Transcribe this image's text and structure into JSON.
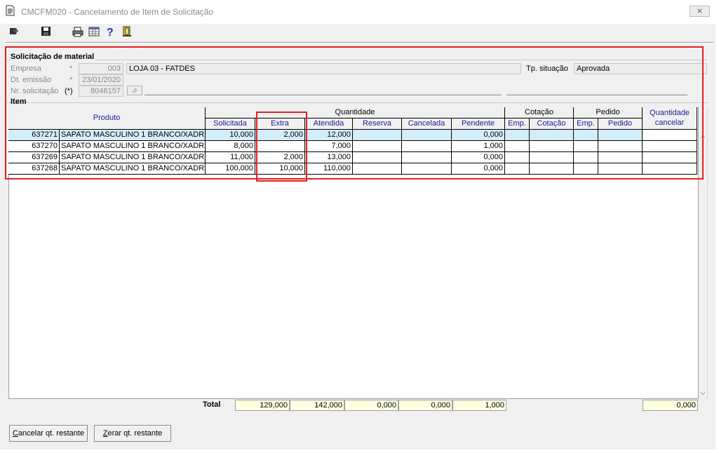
{
  "window": {
    "title": "CMCFM020 - Cancelamento de Item de Solicitação",
    "close_label": "⨯"
  },
  "toolbar": {
    "buttons": [
      "exit-icon",
      "save-icon",
      "print-icon",
      "grid-icon",
      "help-icon",
      "door-icon"
    ]
  },
  "header": {
    "group_title": "Solicitação de material",
    "empresa_label": "Empresa",
    "empresa_required": "*",
    "empresa_code": "003",
    "empresa_name": "LOJA 03 - FATDES",
    "dt_label": "Dt. emissão",
    "dt_required": "*",
    "dt_value": "23/01/2020",
    "nr_label": "Nr. solicitação",
    "nr_required": "(*)",
    "nr_value": "8046157",
    "tp_label": "Tp. situação",
    "tp_value": "Aprovada"
  },
  "grid": {
    "section_title": "Item",
    "headers": {
      "produto": "Produto",
      "quantidade": "Quantidade",
      "cotacao": "Cotação",
      "pedido": "Pedido",
      "qtd_cancelar": "Quantidade cancelar",
      "solicitada": "Solicitada",
      "extra": "Extra",
      "atendida": "Atendida",
      "reserva": "Reserva",
      "cancelada": "Cancelada",
      "pendente": "Pendente",
      "cot_emp": "Emp.",
      "cot_cotacao": "Cotação",
      "ped_emp": "Emp.",
      "ped_pedido": "Pedido"
    },
    "rows": [
      {
        "code": "637271",
        "desc": "SAPATO MASCULINO 1 BRANCO/XADREZ.",
        "solicitada": "10,000",
        "extra": "2,000",
        "atendida": "12,000",
        "reserva": "",
        "cancelada": "",
        "pendente": "0,000"
      },
      {
        "code": "637270",
        "desc": "SAPATO MASCULINO 1 BRANCO/XADREZ.",
        "solicitada": "8,000",
        "extra": "",
        "atendida": "7,000",
        "reserva": "",
        "cancelada": "",
        "pendente": "1,000"
      },
      {
        "code": "637269",
        "desc": "SAPATO MASCULINO 1 BRANCO/XADREZ.",
        "solicitada": "11,000",
        "extra": "2,000",
        "atendida": "13,000",
        "reserva": "",
        "cancelada": "",
        "pendente": "0,000"
      },
      {
        "code": "637268",
        "desc": "SAPATO MASCULINO 1 BRANCO/XADREZ.",
        "solicitada": "100,000",
        "extra": "10,000",
        "atendida": "110,000",
        "reserva": "",
        "cancelada": "",
        "pendente": "0,000"
      }
    ]
  },
  "totals": {
    "label": "Total",
    "solicitada": "129,000",
    "atendida": "142,000",
    "reserva": "0,000",
    "cancelada": "0,000",
    "pendente": "1,000",
    "qtd_cancelar": "0,000"
  },
  "buttons": {
    "cancelar_first": "C",
    "cancelar_rest": "ancelar qt. restante",
    "zerar_first": "Z",
    "zerar_rest": "erar qt. restante"
  },
  "colors": {
    "annotation": "#e32020",
    "selected_row": "#d4edfa",
    "totals_bg": "#ffffe1",
    "header_text": "#1a1a9c"
  }
}
